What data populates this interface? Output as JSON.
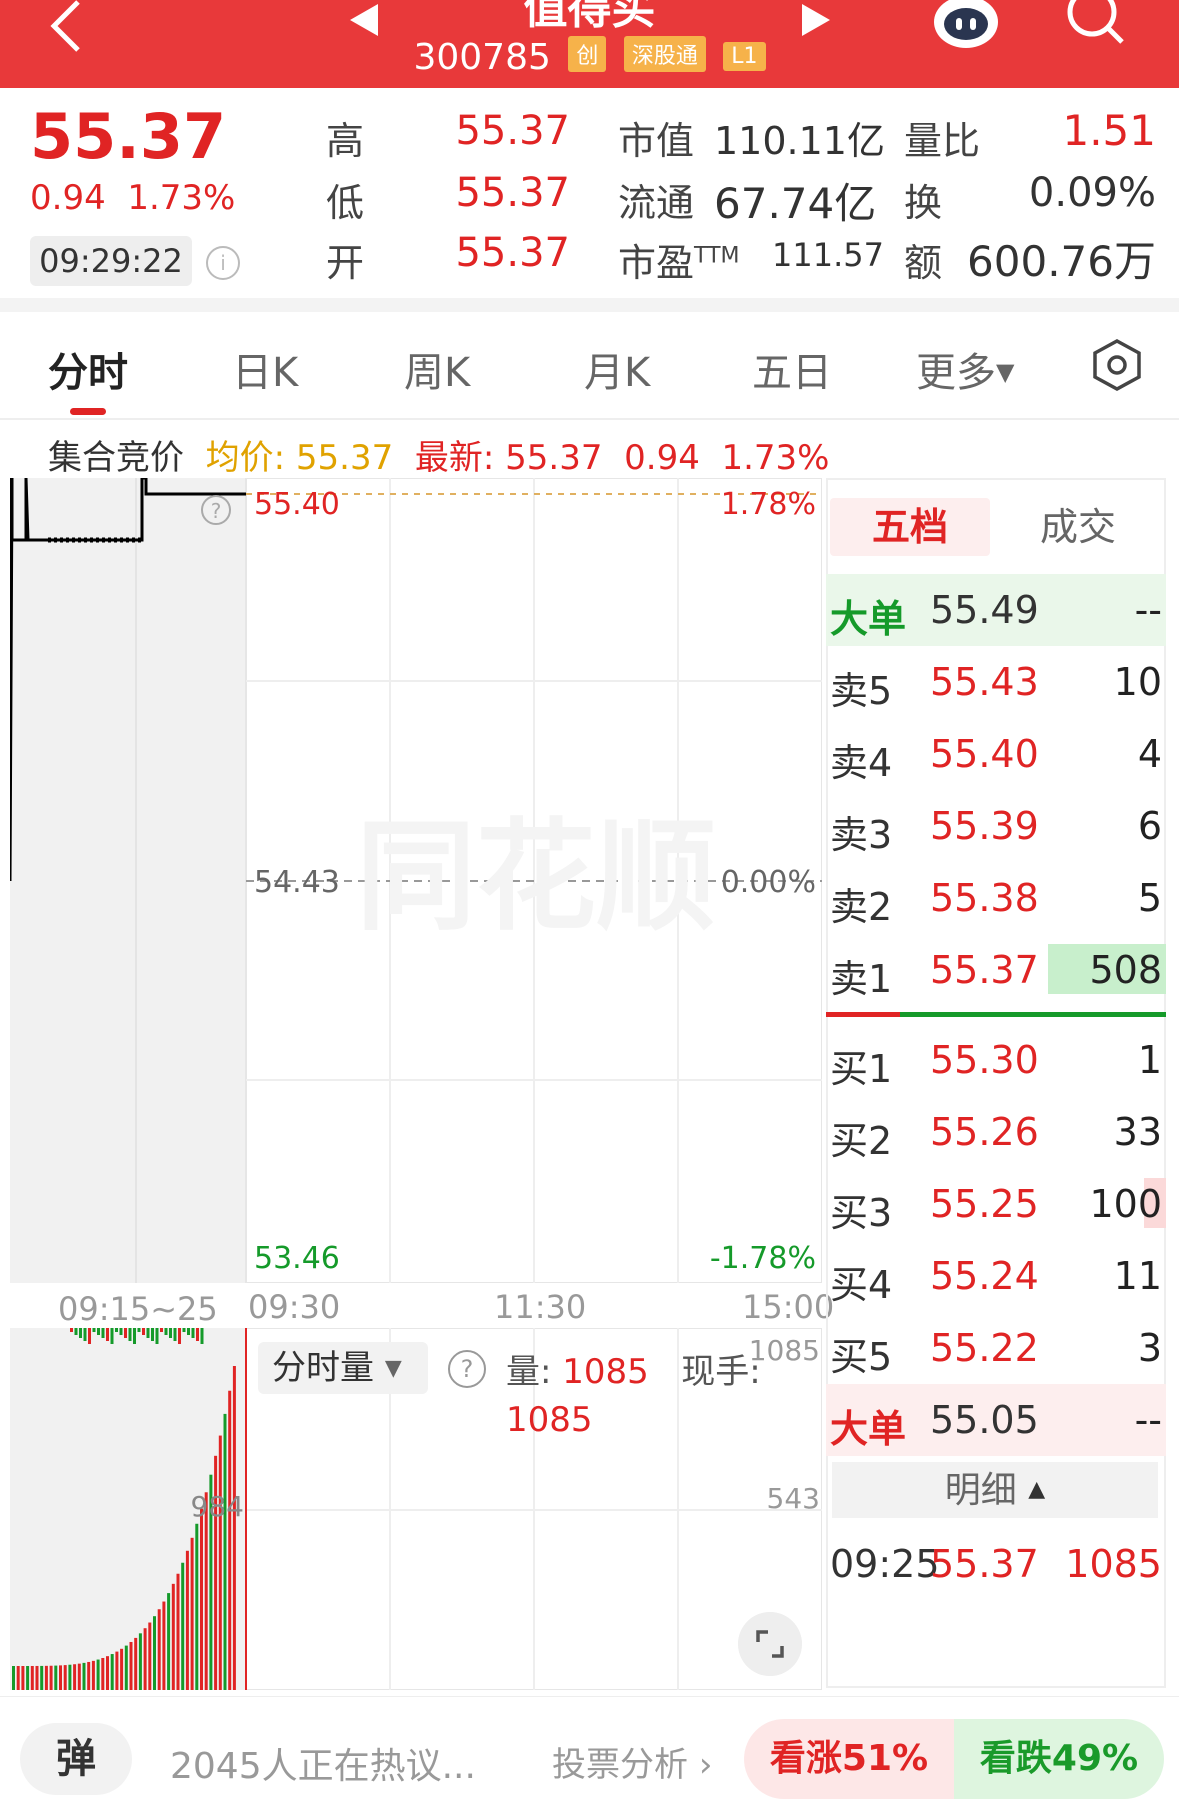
{
  "header": {
    "stock_name": "值得买",
    "code": "300785",
    "tags": [
      "创",
      "深股通",
      "L1"
    ]
  },
  "quote": {
    "price": "55.37",
    "change": "0.94",
    "change_pct": "1.73%",
    "time": "09:29:22",
    "high_label": "高",
    "high": "55.37",
    "low_label": "低",
    "low": "55.37",
    "open_label": "开",
    "open": "55.37",
    "mktcap_label": "市值",
    "mktcap": "110.11亿",
    "float_label": "流通",
    "float": "67.74亿",
    "pe_label": "市盈",
    "pe_sup": "TTM",
    "pe": "111.57",
    "volratio_label": "量比",
    "volratio": "1.51",
    "turnover_label": "换",
    "turnover": "0.09%",
    "amount_label": "额",
    "amount": "600.76万"
  },
  "tabs": [
    "分时",
    "日K",
    "周K",
    "月K",
    "五日",
    "更多"
  ],
  "status": {
    "phase": "集合竞价",
    "avg_label": "均价:",
    "avg": "55.37",
    "last_label": "最新:",
    "last": "55.37",
    "chg": "0.94",
    "pct": "1.73%"
  },
  "chart": {
    "price_high": "55.40",
    "price_mid": "54.43",
    "price_low": "53.46",
    "pct_high": "1.78%",
    "pct_mid": "0.00%",
    "pct_low": "-1.78%",
    "time_pre": "09:15~25",
    "time_open": "09:30",
    "time_mid": "11:30",
    "time_close": "15:00",
    "watermark": "同花顺",
    "pre_vol_tick": "984"
  },
  "volume": {
    "selector": "分时量",
    "vol_label": "量:",
    "vol": "1085",
    "vol2": "1085",
    "now_hand_label": "现手:",
    "max_tick": "1085",
    "mid_tick": "543"
  },
  "orderbook": {
    "tab_active": "五档",
    "tab_other": "成交",
    "big_sell_label": "大单",
    "big_sell_price": "55.49",
    "big_sell_vol": "--",
    "asks": [
      {
        "label": "卖5",
        "price": "55.43",
        "vol": "10"
      },
      {
        "label": "卖4",
        "price": "55.40",
        "vol": "4"
      },
      {
        "label": "卖3",
        "price": "55.39",
        "vol": "6"
      },
      {
        "label": "卖2",
        "price": "55.38",
        "vol": "5"
      },
      {
        "label": "卖1",
        "price": "55.37",
        "vol": "508"
      }
    ],
    "bids": [
      {
        "label": "买1",
        "price": "55.30",
        "vol": "1"
      },
      {
        "label": "买2",
        "price": "55.26",
        "vol": "33"
      },
      {
        "label": "买3",
        "price": "55.25",
        "vol": "100"
      },
      {
        "label": "买4",
        "price": "55.24",
        "vol": "11"
      },
      {
        "label": "买5",
        "price": "55.22",
        "vol": "3"
      }
    ],
    "big_buy_label": "大单",
    "big_buy_price": "55.05",
    "big_buy_vol": "--",
    "detail_label": "明细",
    "last_trade_time": "09:25",
    "last_trade_price": "55.37",
    "last_trade_vol": "1085"
  },
  "bottom": {
    "danmu": "弹",
    "hot": "2045人正在热议...",
    "vote": "投票分析",
    "bull": "看涨51%",
    "bear": "看跌49%"
  },
  "colors": {
    "up": "#e02424",
    "down": "#159a2a",
    "header": "#e8393a",
    "avg": "#e0a200"
  }
}
